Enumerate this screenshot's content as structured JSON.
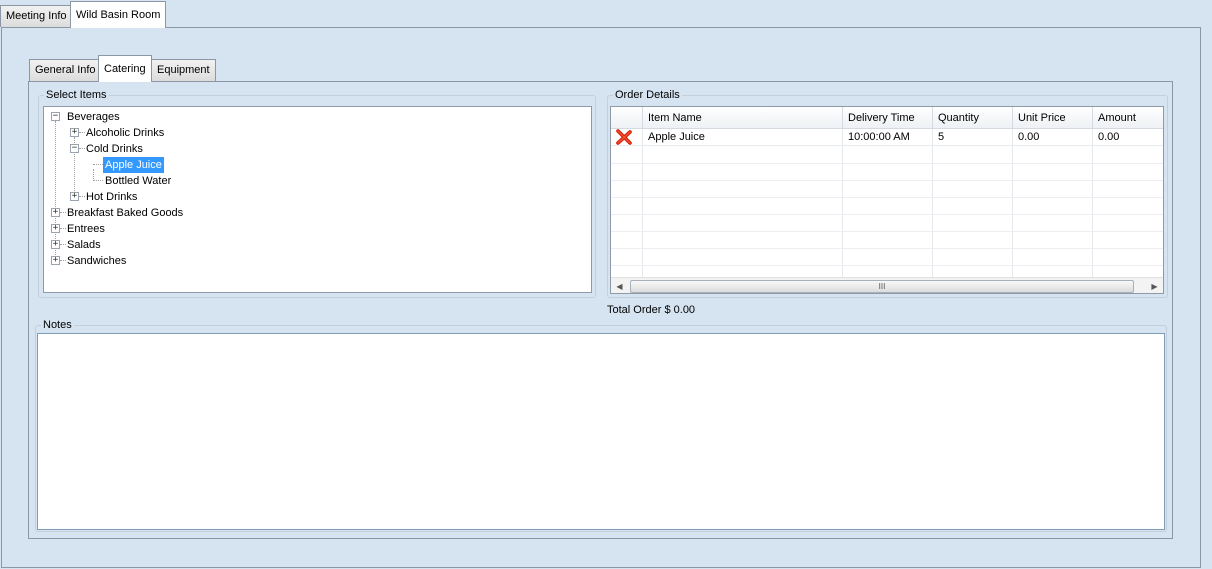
{
  "outer_tabs": [
    {
      "label": "Meeting Info",
      "active": false
    },
    {
      "label": "Wild Basin Room",
      "active": true
    }
  ],
  "inner_tabs": [
    {
      "label": "General Info",
      "active": false
    },
    {
      "label": "Catering",
      "active": true
    },
    {
      "label": "Equipment",
      "active": false
    }
  ],
  "select_items": {
    "title": "Select Items",
    "tree": {
      "beverages": "Beverages",
      "alcoholic": "Alcoholic Drinks",
      "cold": "Cold Drinks",
      "apple_juice": "Apple Juice",
      "bottled_water": "Bottled Water",
      "hot": "Hot Drinks",
      "breakfast": "Breakfast Baked Goods",
      "entrees": "Entrees",
      "salads": "Salads",
      "sandwiches": "Sandwiches"
    },
    "selected": "Apple Juice"
  },
  "order_details": {
    "title": "Order Details",
    "columns": [
      "Item Name",
      "Delivery Time",
      "Quantity",
      "Unit Price",
      "Amount"
    ],
    "rows": [
      {
        "item": "Apple Juice",
        "time": "10:00:00 AM",
        "qty": "5",
        "unit": "0.00",
        "amount": "0.00"
      }
    ],
    "delete_icon": "delete-x-icon",
    "scroll_thumb": "III"
  },
  "total": "Total Order $ 0.00",
  "notes": {
    "title": "Notes",
    "value": ""
  },
  "colors": {
    "background": "#d6e3f0",
    "selection": "#3399ff",
    "delete": "#d81e05"
  }
}
